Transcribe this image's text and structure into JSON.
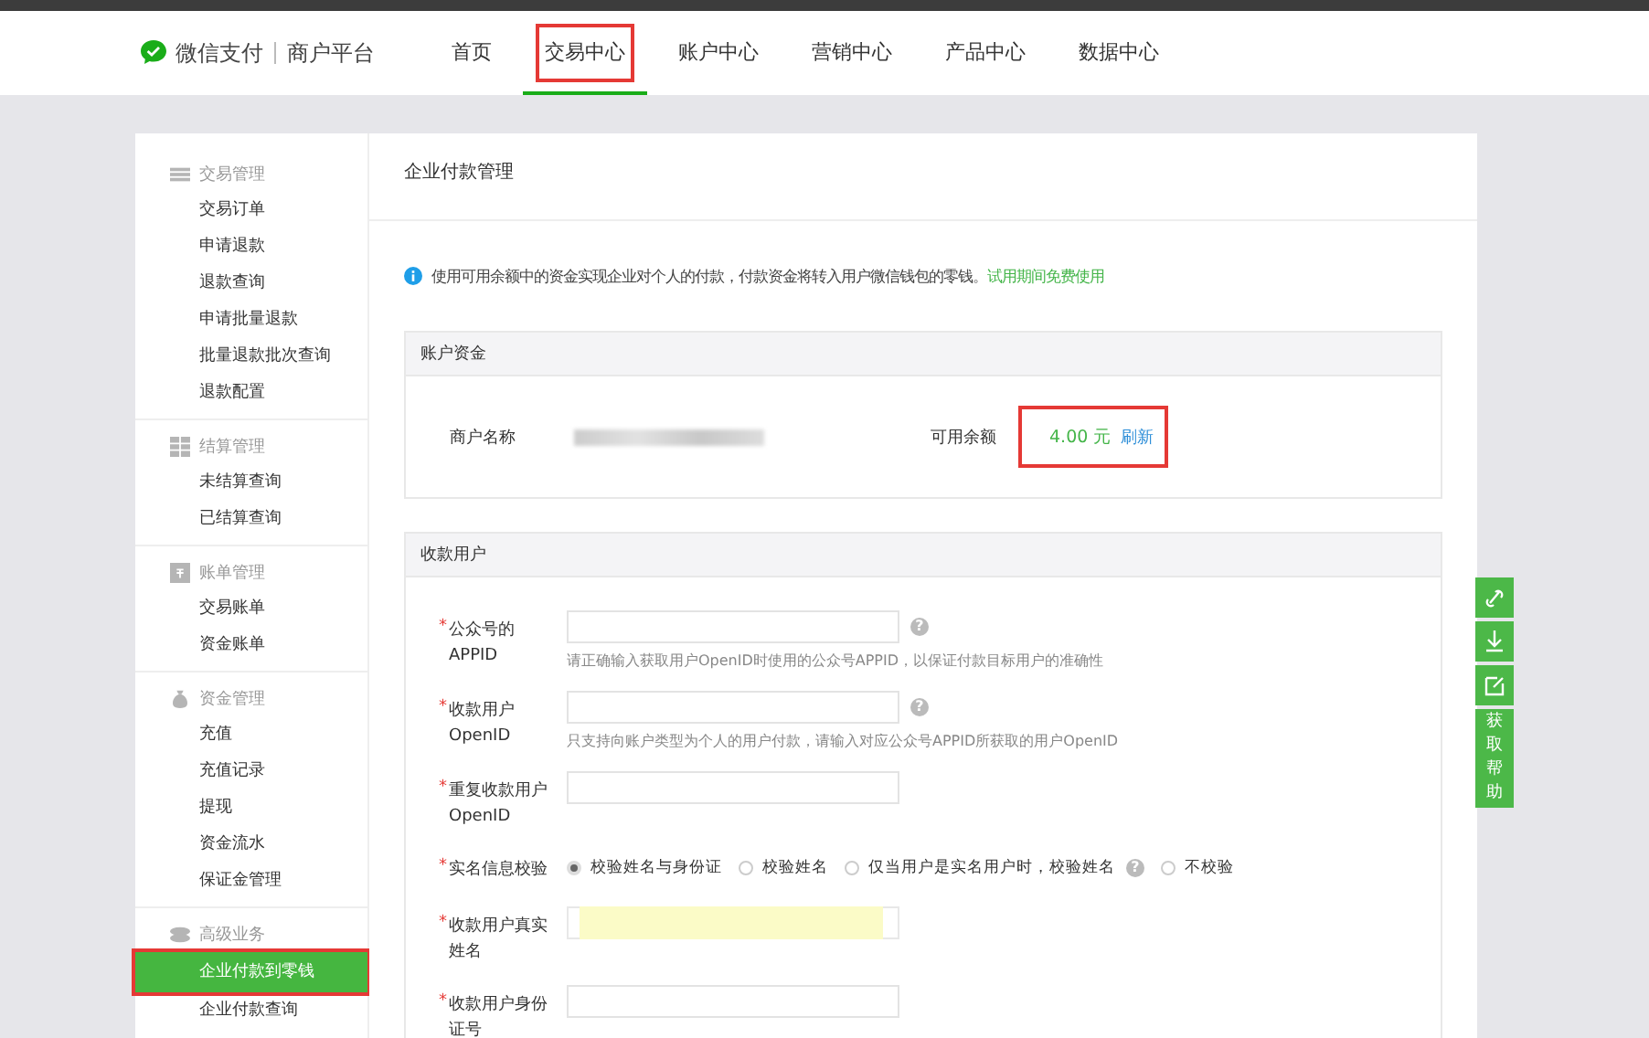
{
  "header": {
    "logo": "微信支付",
    "platform": "商户平台",
    "nav": [
      {
        "label": "首页",
        "selected": false,
        "highlighted": false
      },
      {
        "label": "交易中心",
        "selected": true,
        "highlighted": true
      },
      {
        "label": "账户中心",
        "selected": false,
        "highlighted": false
      },
      {
        "label": "营销中心",
        "selected": false,
        "highlighted": false
      },
      {
        "label": "产品中心",
        "selected": false,
        "highlighted": false
      },
      {
        "label": "数据中心",
        "selected": false,
        "highlighted": false
      }
    ]
  },
  "sidebar": {
    "groups": [
      {
        "title": "交易管理",
        "items": [
          {
            "label": "交易订单",
            "selected": false,
            "highlighted": false
          },
          {
            "label": "申请退款",
            "selected": false,
            "highlighted": false
          },
          {
            "label": "退款查询",
            "selected": false,
            "highlighted": false
          },
          {
            "label": "申请批量退款",
            "selected": false,
            "highlighted": false
          },
          {
            "label": "批量退款批次查询",
            "selected": false,
            "highlighted": false
          },
          {
            "label": "退款配置",
            "selected": false,
            "highlighted": false
          }
        ]
      },
      {
        "title": "结算管理",
        "items": [
          {
            "label": "未结算查询",
            "selected": false,
            "highlighted": false
          },
          {
            "label": "已结算查询",
            "selected": false,
            "highlighted": false
          }
        ]
      },
      {
        "title": "账单管理",
        "items": [
          {
            "label": "交易账单",
            "selected": false,
            "highlighted": false
          },
          {
            "label": "资金账单",
            "selected": false,
            "highlighted": false
          }
        ]
      },
      {
        "title": "资金管理",
        "items": [
          {
            "label": "充值",
            "selected": false,
            "highlighted": false
          },
          {
            "label": "充值记录",
            "selected": false,
            "highlighted": false
          },
          {
            "label": "提现",
            "selected": false,
            "highlighted": false
          },
          {
            "label": "资金流水",
            "selected": false,
            "highlighted": false
          },
          {
            "label": "保证金管理",
            "selected": false,
            "highlighted": false
          }
        ]
      },
      {
        "title": "高级业务",
        "items": [
          {
            "label": "企业付款到零钱",
            "selected": true,
            "highlighted": true
          },
          {
            "label": "企业付款查询",
            "selected": false,
            "highlighted": false
          }
        ]
      }
    ]
  },
  "page": {
    "title": "企业付款管理",
    "notice": "使用可用余额中的资金实现企业对个人的付款，付款资金将转入用户微信钱包的零钱。",
    "notice_link": "试用期间免费使用",
    "account": {
      "title": "账户资金",
      "name_label": "商户名称",
      "balance_label": "可用余额",
      "balance": "4.00 元",
      "refresh": "刷新",
      "highlighted": true
    },
    "payee": {
      "title": "收款用户",
      "fields": [
        {
          "kind": "input",
          "required_mark": "*",
          "label": "公众号的APPID",
          "help_mark": "?",
          "hint": "请正确输入获取用户OpenID时使用的公众号APPID，以保证付款目标用户的准确性",
          "filled": false
        },
        {
          "kind": "input",
          "required_mark": "*",
          "label": "收款用户OpenID",
          "help_mark": "?",
          "hint": "只支持向账户类型为个人的用户付款，请输入对应公众号APPID所获取的用户OpenID",
          "filled": false
        },
        {
          "kind": "input",
          "required_mark": "*",
          "label": "重复收款用户OpenID",
          "filled": false
        },
        {
          "kind": "radio",
          "required_mark": "*",
          "label": "实名信息校验",
          "options": [
            {
              "label": "校验姓名与身份证",
              "selected": true
            },
            {
              "label": "校验姓名",
              "selected": false
            },
            {
              "label": "仅当用户是实名用户时，校验姓名",
              "selected": false,
              "help_mark": "?"
            },
            {
              "label": "不校验",
              "selected": false
            }
          ]
        },
        {
          "kind": "input",
          "required_mark": "*",
          "label": "收款用户真实姓名",
          "filled": true
        },
        {
          "kind": "input",
          "required_mark": "*",
          "label": "收款用户身份证号",
          "filled": false
        }
      ]
    }
  },
  "help_bar": {
    "label": "获取帮助"
  }
}
